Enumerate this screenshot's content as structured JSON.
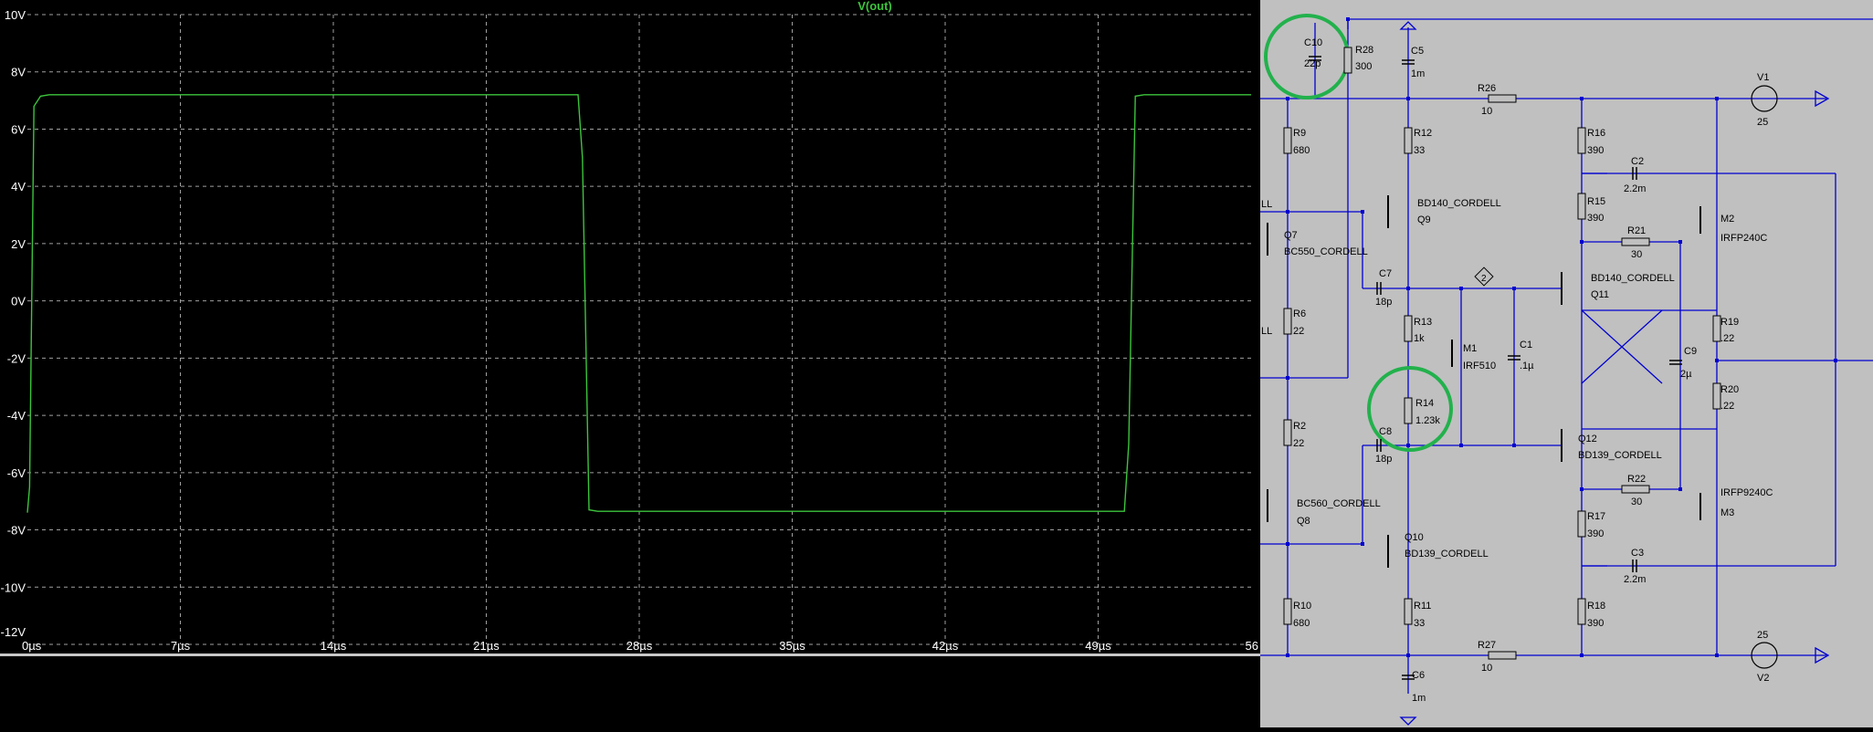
{
  "waveform": {
    "trace_label": "V(out)",
    "trace_color": "#3cc43c",
    "grid_color": "#a0a0a0",
    "y_ticks": [
      "10V",
      "8V",
      "6V",
      "4V",
      "2V",
      "0V",
      "-2V",
      "-4V",
      "-6V",
      "-8V",
      "-10V",
      "-12V"
    ],
    "x_ticks": [
      "0µs",
      "7µs",
      "14µs",
      "21µs",
      "28µs",
      "35µs",
      "42µs",
      "49µs",
      "56"
    ]
  },
  "chart_data": {
    "type": "line",
    "title": "V(out)",
    "xlabel": "",
    "ylabel": "",
    "xlim": [
      0,
      56
    ],
    "ylim": [
      -12,
      10
    ],
    "x_unit": "µs",
    "y_unit": "V",
    "series": [
      {
        "name": "V(out)",
        "x": [
          0,
          0.1,
          0.3,
          0.6,
          1.0,
          25.2,
          25.4,
          25.7,
          26.1,
          50.2,
          50.4,
          50.7,
          51.1,
          56
        ],
        "y": [
          -7.4,
          -6.5,
          6.8,
          7.15,
          7.2,
          7.2,
          5.0,
          -7.3,
          -7.35,
          -7.35,
          -5.0,
          7.15,
          7.2,
          7.2
        ]
      }
    ]
  },
  "schematic": {
    "wire_color": "#0000d0",
    "text_color": "#000000",
    "highlight_color": "#22b14c",
    "labels": {
      "c10": "C10",
      "c10_val": "22p",
      "r28": "R28",
      "r28_val": "300",
      "c5": "C5",
      "c5_val": "1m",
      "r26": "R26",
      "r26_val": "10",
      "v1": "V1",
      "v1_val": "25",
      "r9": "R9",
      "r9_val": "680",
      "r12": "R12",
      "r12_val": "33",
      "r16": "R16",
      "r16_val": "390",
      "c2": "C2",
      "c2_val": "2.2m",
      "q9_model": "BD140_CORDELL",
      "q9": "Q9",
      "r15": "R15",
      "r15_val": "390",
      "m2": "M2",
      "m2_model": "IRFP240C",
      "r21": "R21",
      "r21_val": "30",
      "left_ll_1": "LL",
      "left_ll_2": "LL",
      "q7": "Q7",
      "q7_model": "BC550_CORDELL",
      "c7": "C7",
      "c7_val": "18p",
      "net_flag": "2",
      "q11_model": "BD140_CORDELL",
      "q11": "Q11",
      "r6": "R6",
      "r6_val": "22",
      "r13": "R13",
      "r13_val": "1k",
      "r19": "R19",
      "r19_val": ".22",
      "m1": "M1",
      "m1_model": "IRF510",
      "c1": "C1",
      "c1_val": ".1µ",
      "c9": "C9",
      "c9_val": "2µ",
      "r20": "R20",
      "r20_val": ".22",
      "r14": "R14",
      "r14_val": "1.23k",
      "r2": "R2",
      "r2_val": "22",
      "c8": "C8",
      "c8_val": "18p",
      "q12": "Q12",
      "q12_model": "BD139_CORDELL",
      "r22": "R22",
      "r22_val": "30",
      "m3_model": "IRFP9240C",
      "m3": "M3",
      "q8_model": "BC560_CORDELL",
      "q8": "Q8",
      "r17": "R17",
      "r17_val": "390",
      "q10": "Q10",
      "q10_model": "BD139_CORDELL",
      "c3": "C3",
      "c3_val": "2.2m",
      "r10": "R10",
      "r10_val": "680",
      "r11": "R11",
      "r11_val": "33",
      "r18": "R18",
      "r18_val": "390",
      "r27": "R27",
      "r27_val": "10",
      "v2_val": "25",
      "v2": "V2",
      "c6": "C6",
      "c6_val": "1m"
    }
  }
}
